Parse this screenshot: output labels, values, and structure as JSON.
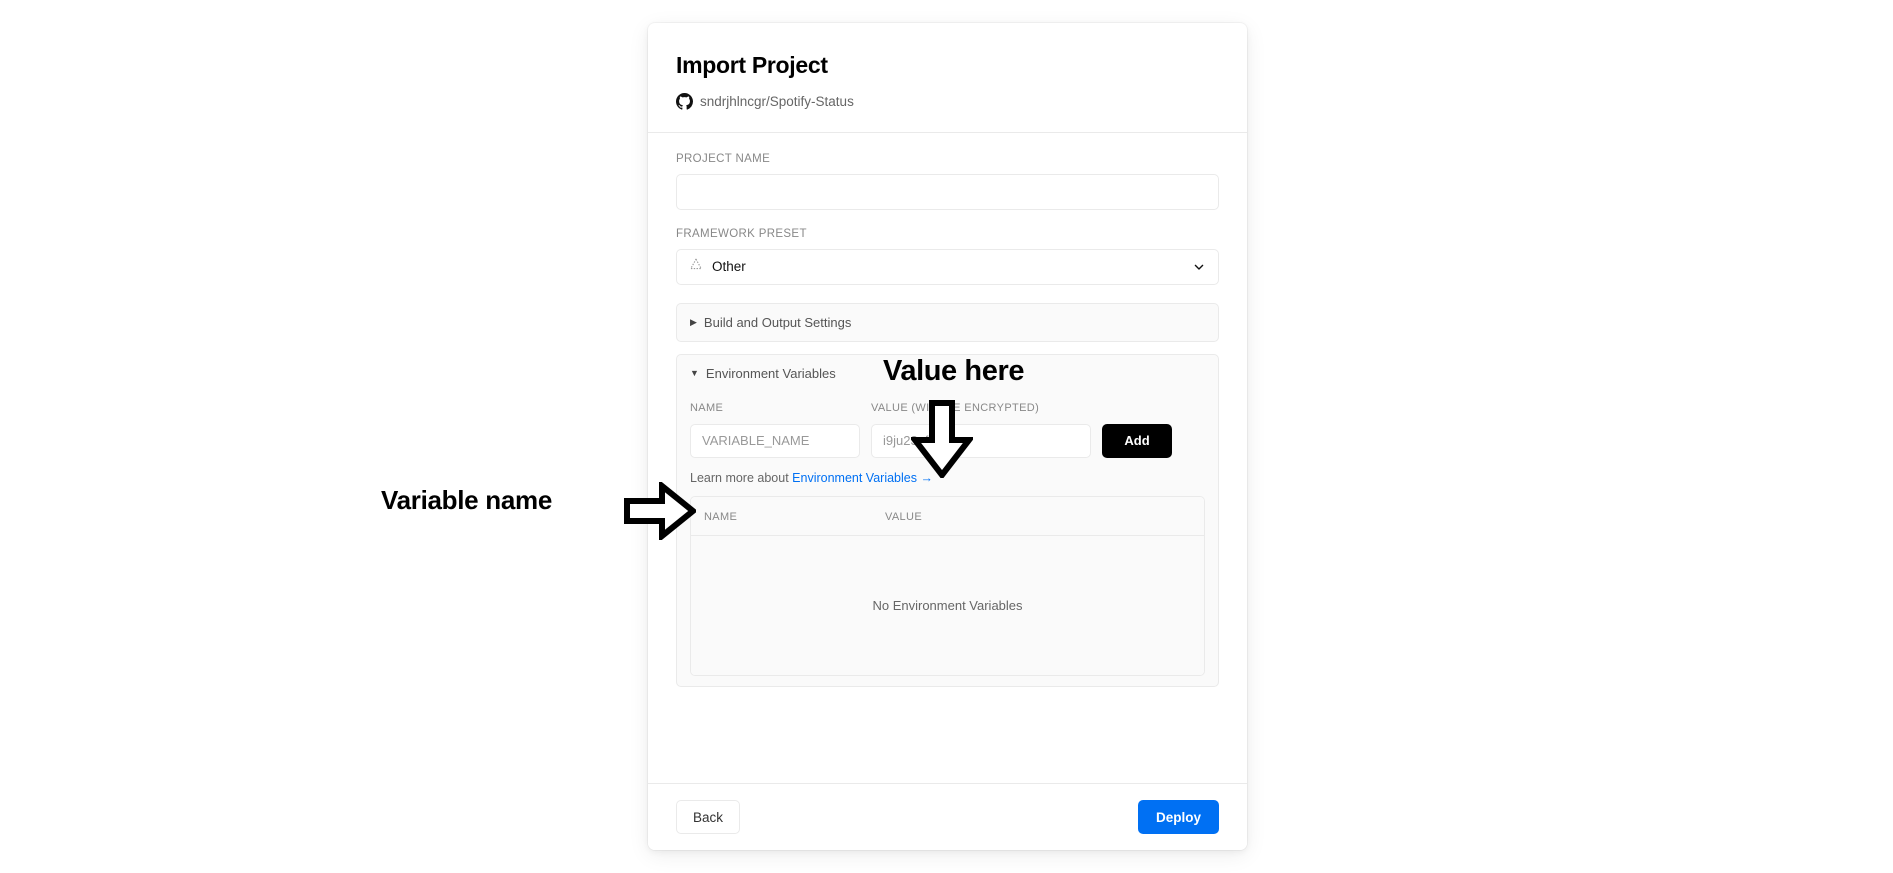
{
  "card": {
    "title": "Import Project",
    "repo": {
      "icon": "github-icon",
      "name": "sndrjhlncgr/Spotify-Status"
    }
  },
  "form": {
    "project_name": {
      "label": "PROJECT NAME",
      "value": "",
      "placeholder": ""
    },
    "framework_preset": {
      "label": "FRAMEWORK PRESET",
      "selected": "Other",
      "icon": "dotted-triangle-icon",
      "chevron": "chevron-down-icon"
    }
  },
  "build_panel": {
    "title": "Build and Output Settings",
    "expanded": false,
    "triangle": "▶"
  },
  "env_panel": {
    "title": "Environment Variables",
    "expanded": true,
    "triangle": "▼",
    "col_name_label": "NAME",
    "col_value_label": "VALUE (WILL BE ENCRYPTED)",
    "name_input": {
      "value": "",
      "placeholder": "VARIABLE_NAME"
    },
    "value_input": {
      "value": "",
      "placeholder": "i9ju23nf39"
    },
    "add_button": "Add",
    "learn_more_prefix": "Learn more about ",
    "learn_more_link": "Environment Variables →",
    "table": {
      "headers": [
        "NAME",
        "VALUE"
      ],
      "rows": [],
      "empty_message": "No Environment Variables"
    }
  },
  "footer": {
    "back_label": "Back",
    "deploy_label": "Deploy"
  },
  "annotations": [
    {
      "text": "Value here",
      "arrow": "arrow-down"
    },
    {
      "text": "Variable name",
      "arrow": "arrow-right"
    }
  ],
  "colors": {
    "accent_blue": "#0070f3",
    "black": "#000000",
    "border": "#eaeaea",
    "panel_bg": "#fafafa",
    "muted_text": "#888888"
  }
}
